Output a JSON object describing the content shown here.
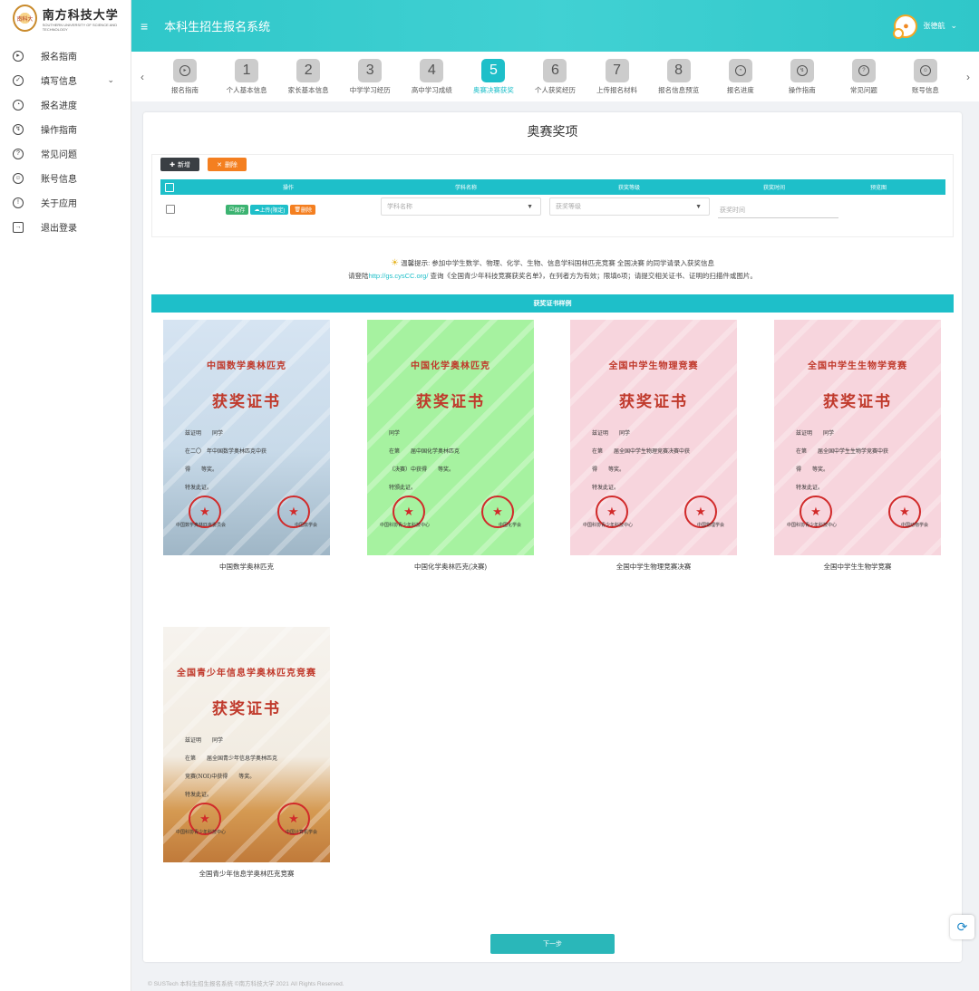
{
  "logo": {
    "seal": "南科大",
    "name": "南方科技大学",
    "en": "SOUTHERN UNIVERSITY OF SCIENCE AND TECHNOLOGY"
  },
  "sidebar": {
    "items": [
      {
        "label": "报名指南",
        "icon": "play-circle-icon"
      },
      {
        "label": "填写信息",
        "icon": "edit-icon",
        "has_submenu": true
      },
      {
        "label": "报名进度",
        "icon": "gauge-icon"
      },
      {
        "label": "操作指南",
        "icon": "compass-icon"
      },
      {
        "label": "常见问题",
        "icon": "question-icon"
      },
      {
        "label": "账号信息",
        "icon": "user-circle-icon"
      },
      {
        "label": "关于应用",
        "icon": "info-icon"
      },
      {
        "label": "退出登录",
        "icon": "logout-icon"
      }
    ]
  },
  "header": {
    "title": "本科生招生报名系统",
    "user_name": "张德航"
  },
  "steps": [
    {
      "num": "",
      "label": "报名指南"
    },
    {
      "num": "1",
      "label": "个人基本信息"
    },
    {
      "num": "2",
      "label": "家长基本信息"
    },
    {
      "num": "3",
      "label": "中学学习经历"
    },
    {
      "num": "4",
      "label": "高中学习成绩"
    },
    {
      "num": "5",
      "label": "奥赛决赛获奖",
      "active": true
    },
    {
      "num": "6",
      "label": "个人获奖经历"
    },
    {
      "num": "7",
      "label": "上传报名材料"
    },
    {
      "num": "8",
      "label": "报名信息预览"
    },
    {
      "num": "",
      "label": "报名进度"
    },
    {
      "num": "",
      "label": "操作指南"
    },
    {
      "num": "",
      "label": "常见问题"
    },
    {
      "num": "",
      "label": "账号信息"
    }
  ],
  "main": {
    "title": "奥赛奖项",
    "add_label": "新增",
    "delete_label": "删除",
    "columns": [
      "操作",
      "学科名称",
      "获奖等级",
      "获奖时间",
      "预览图"
    ],
    "row": {
      "save": "保存",
      "upload": "上传(限定)",
      "delete": "删除",
      "subject_placeholder": "学科名称",
      "level_placeholder": "获奖等级",
      "date_placeholder": "获奖时间"
    },
    "tip_line1": "温馨提示: 参加中学生数学、物理、化学、生物、信息学科国林匹克竞赛 全国决赛 的同学请录入获奖信息",
    "tip_line2_pre": "请登陆",
    "tip_link": "http://gs.cysCC.org/",
    "tip_line2_post": " 查询《全国青少年科技竞赛获奖名单》，在列者方为有效；限填6项；请提交相关证书、证明的扫描件或图片。",
    "samples_title": "获奖证书样例",
    "next": "下一步"
  },
  "certs": [
    {
      "title": "中国数学奥林匹克",
      "heading": "获奖证书",
      "caption": "中国数学奥林匹克",
      "bg": "#cfe0ef",
      "lines": [
        "兹证明　　同学",
        "在二〇　年中国数学奥林匹克中获",
        "得　　等奖。",
        "特发此证。"
      ],
      "org_l": "中国数学奥林匹克委员会",
      "org_r": "中国数学会"
    },
    {
      "title": "中国化学奥林匹克",
      "heading": "获奖证书",
      "caption": "中国化学奥林匹克(决赛)",
      "bg": "#a6f2a0",
      "lines": [
        "同学",
        "在第　　届中国化学奥林匹克",
        "（决赛）中获得　　等奖。",
        "特颁此证。"
      ],
      "org_l": "中国科协青少年科技中心",
      "org_r": "中国化学会"
    },
    {
      "title": "全国中学生物理竞赛",
      "heading": "获奖证书",
      "caption": "全国中学生物理竞赛决赛",
      "bg": "#f7d5dd",
      "lines": [
        "兹证明　　同学",
        "在第　　届全国中学生物理竞赛决赛中获",
        "得　　等奖。",
        "特发此证。"
      ],
      "org_l": "中国科协青少年科技中心",
      "org_r": "中国物理学会"
    },
    {
      "title": "全国中学生生物学竞赛",
      "heading": "获奖证书",
      "caption": "全国中学生生物学竞赛",
      "bg": "#f7d5dd",
      "lines": [
        "兹证明　　同学",
        "在第　　届全国中学生生物学竞赛中获",
        "得　　等奖。",
        "特发此证。"
      ],
      "org_l": "中国科协青少年科技中心",
      "org_r": "中国动物学会"
    },
    {
      "title": "全国青少年信息学奥林匹克竞赛",
      "heading": "获奖证书",
      "caption": "全国青少年信息学奥林匹克竞赛",
      "bg": "#f3f0ea",
      "lines": [
        "兹证明　　同学",
        "在第　　届全国青少年信息学奥林匹克",
        "竞赛(NOI)中获得　　等奖。",
        "特发此证。"
      ],
      "org_l": "中国科协青少年科技中心",
      "org_r": "中国计算机学会"
    }
  ],
  "footer": "© SUSTech 本科生招生报名系统 ©南方科技大学 2021 All Rights Reserved."
}
